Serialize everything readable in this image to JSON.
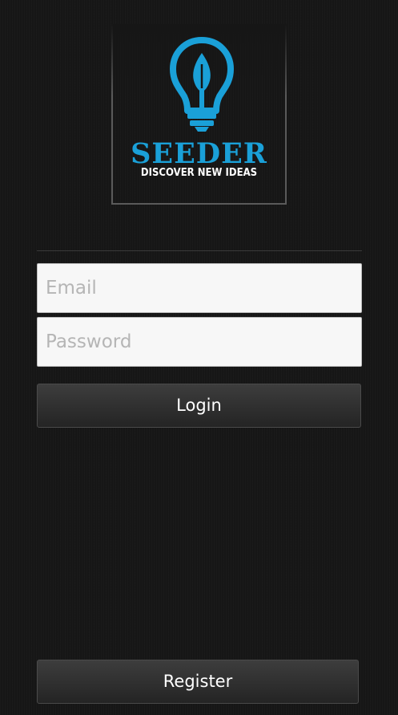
{
  "logo": {
    "icon": "lightbulb-leaf-icon",
    "title": "SEEDER",
    "tagline": "DISCOVER NEW IDEAS",
    "accent_color": "#1aa0d8"
  },
  "form": {
    "email_placeholder": "Email",
    "email_value": "",
    "password_placeholder": "Password",
    "password_value": "",
    "login_label": "Login"
  },
  "footer": {
    "register_label": "Register"
  }
}
